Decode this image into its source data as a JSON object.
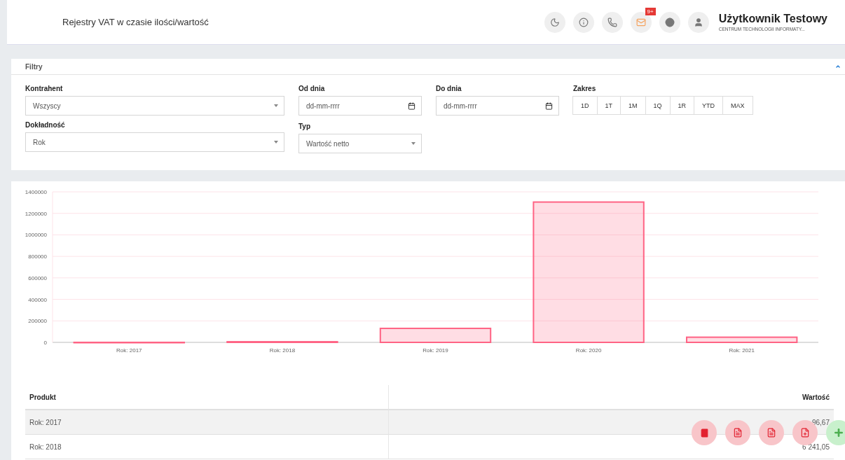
{
  "header": {
    "title": "Rejestry VAT w czasie ilości/wartość",
    "notification_badge": "9+",
    "user_name": "Użytkownik Testowy",
    "user_org": "CENTRUM TECHNOLOGII INFORMATY..."
  },
  "filters": {
    "title": "Filtry",
    "expanded": true,
    "fields": [
      {
        "kind": "select",
        "label": "Kontrahent",
        "value": "Wszyscy"
      },
      {
        "kind": "date",
        "label": "Od dnia",
        "placeholder": "dd-mm-rrrr"
      },
      {
        "kind": "date",
        "label": "Do dnia",
        "placeholder": "dd-mm-rrrr"
      },
      {
        "kind": "range",
        "label": "Zakres",
        "options": [
          "1D",
          "1T",
          "1M",
          "1Q",
          "1R",
          "YTD",
          "MAX"
        ]
      },
      {
        "kind": "select",
        "label": "Dokładność",
        "value": "Rok"
      },
      {
        "kind": "select",
        "label": "Typ",
        "value": "Wartość netto"
      }
    ]
  },
  "chart_data": {
    "type": "bar",
    "categories": [
      "Rok: 2017",
      "Rok: 2018",
      "Rok: 2019",
      "Rok: 2020",
      "Rok: 2021"
    ],
    "series": [
      {
        "color": "#ff6384",
        "values": [
          100,
          6000,
          130000,
          1305000,
          48000
        ]
      }
    ],
    "grid": true,
    "ylim": [
      0,
      1400000
    ],
    "yticks": [
      0,
      200000,
      400000,
      600000,
      800000,
      1000000,
      1200000,
      1400000
    ]
  },
  "table": {
    "columns": [
      "Produkt",
      "Wartość"
    ],
    "rows": [
      {
        "cells": [
          "Rok: 2017",
          "96,67"
        ]
      },
      {
        "cells": [
          "Rok: 2018",
          "6 241,05"
        ]
      }
    ]
  }
}
